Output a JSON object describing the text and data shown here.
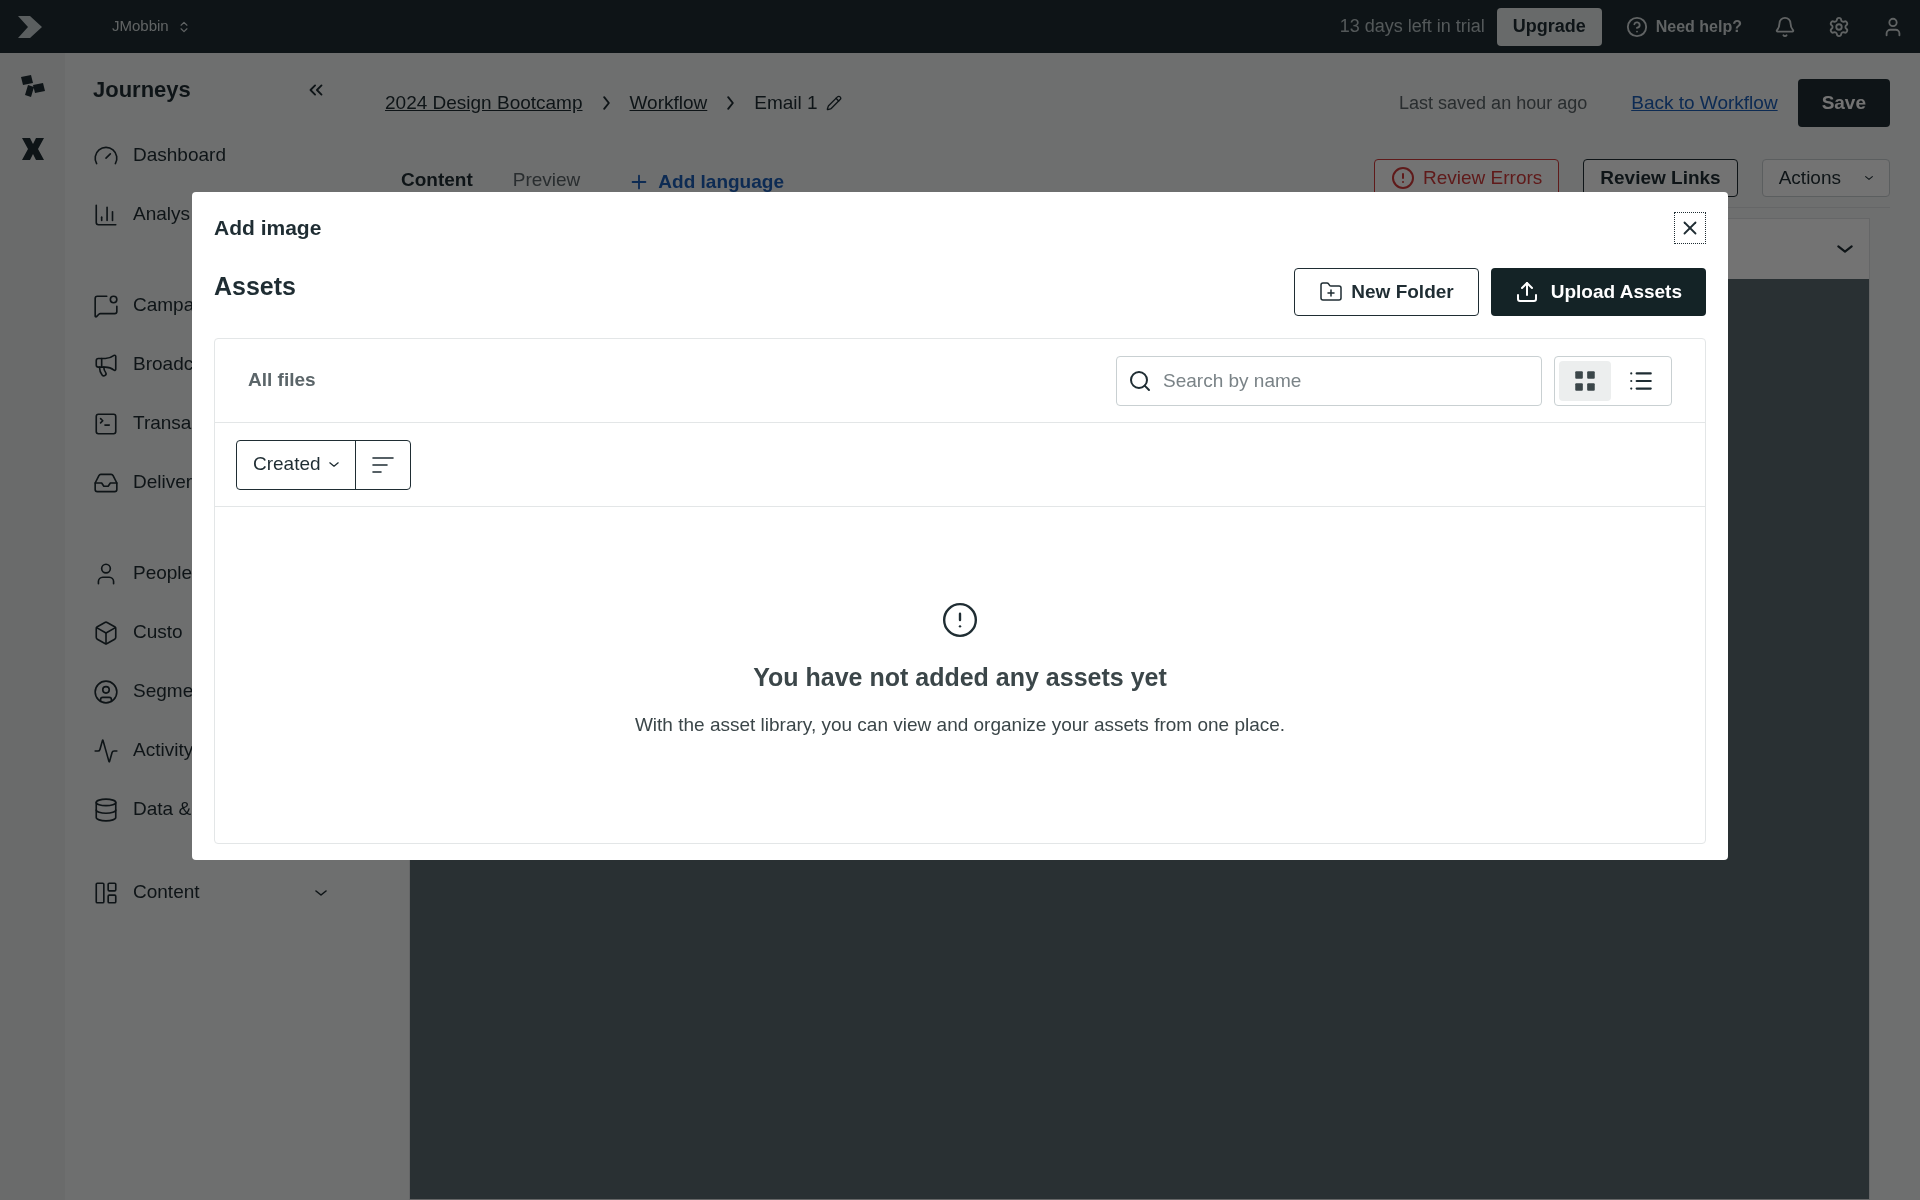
{
  "top_bar": {
    "workspace": "JMobbin",
    "trial": "13 days left in trial",
    "upgrade": "Upgrade",
    "help": "Need help?"
  },
  "sidebar": {
    "title": "Journeys",
    "groups": [
      [
        "Dashboard",
        "Analys"
      ],
      [
        "Campa",
        "Broadc",
        "Transa",
        "Deliver"
      ],
      [
        "People",
        "Custo",
        "Segme",
        "Activity",
        "Data &"
      ]
    ],
    "content_section": {
      "label": "Content",
      "expanded": false
    }
  },
  "breadcrumbs": [
    "2024 Design Bootcamp",
    "Workflow",
    "Email 1"
  ],
  "last_saved": "Last saved an hour ago",
  "back_link": "Back to Workflow",
  "save": "Save",
  "tabs": [
    {
      "label": "Content",
      "selected": true
    },
    {
      "label": "Preview",
      "selected": false
    }
  ],
  "add_language": "Add language",
  "actions": {
    "review_errors": "Review Errors",
    "review_links": "Review Links",
    "menu": "Actions"
  },
  "modal": {
    "title": "Add image",
    "heading": "Assets",
    "new_folder": "New Folder",
    "upload": "Upload Assets",
    "section": "All files",
    "search": {
      "placeholder": "Search by name"
    },
    "views": [
      {
        "kind": "grid",
        "selected": true
      },
      {
        "kind": "list",
        "selected": false
      }
    ],
    "sort": "Created",
    "empty": {
      "title": "You have not added any assets yet",
      "text": "With the asset library, you can view and organize your assets from one place."
    }
  }
}
